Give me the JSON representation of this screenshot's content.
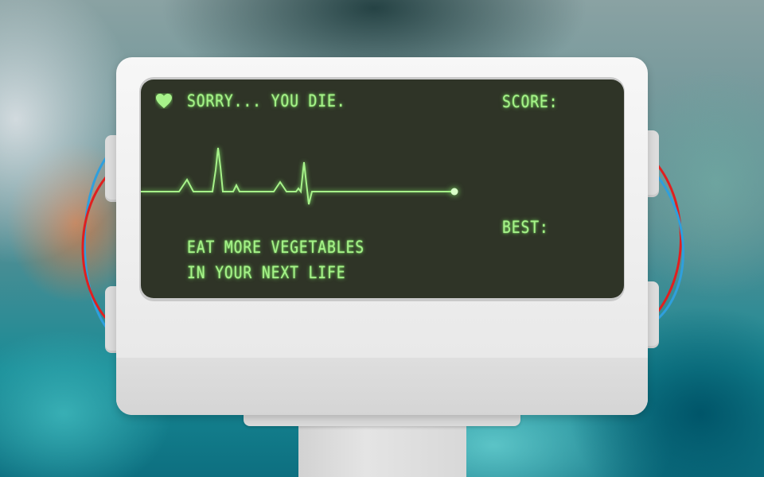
{
  "game": {
    "status_text": "SORRY... YOU DIE.",
    "score_label": "SCORE:",
    "score_value": "",
    "best_label": "BEST:",
    "best_value": "",
    "message_line1": "EAT MORE VEGETABLES",
    "message_line2": "IN YOUR NEXT LIFE"
  },
  "icons": {
    "life": "heart-icon",
    "monitor": "heart-rate-monitor"
  },
  "colors": {
    "screen_background": "#2f3427",
    "lcd_green": "#a7f28a",
    "monitor_body": "#ededed",
    "wire_blue": "#2f9fdd",
    "wire_red": "#e01f1f"
  }
}
